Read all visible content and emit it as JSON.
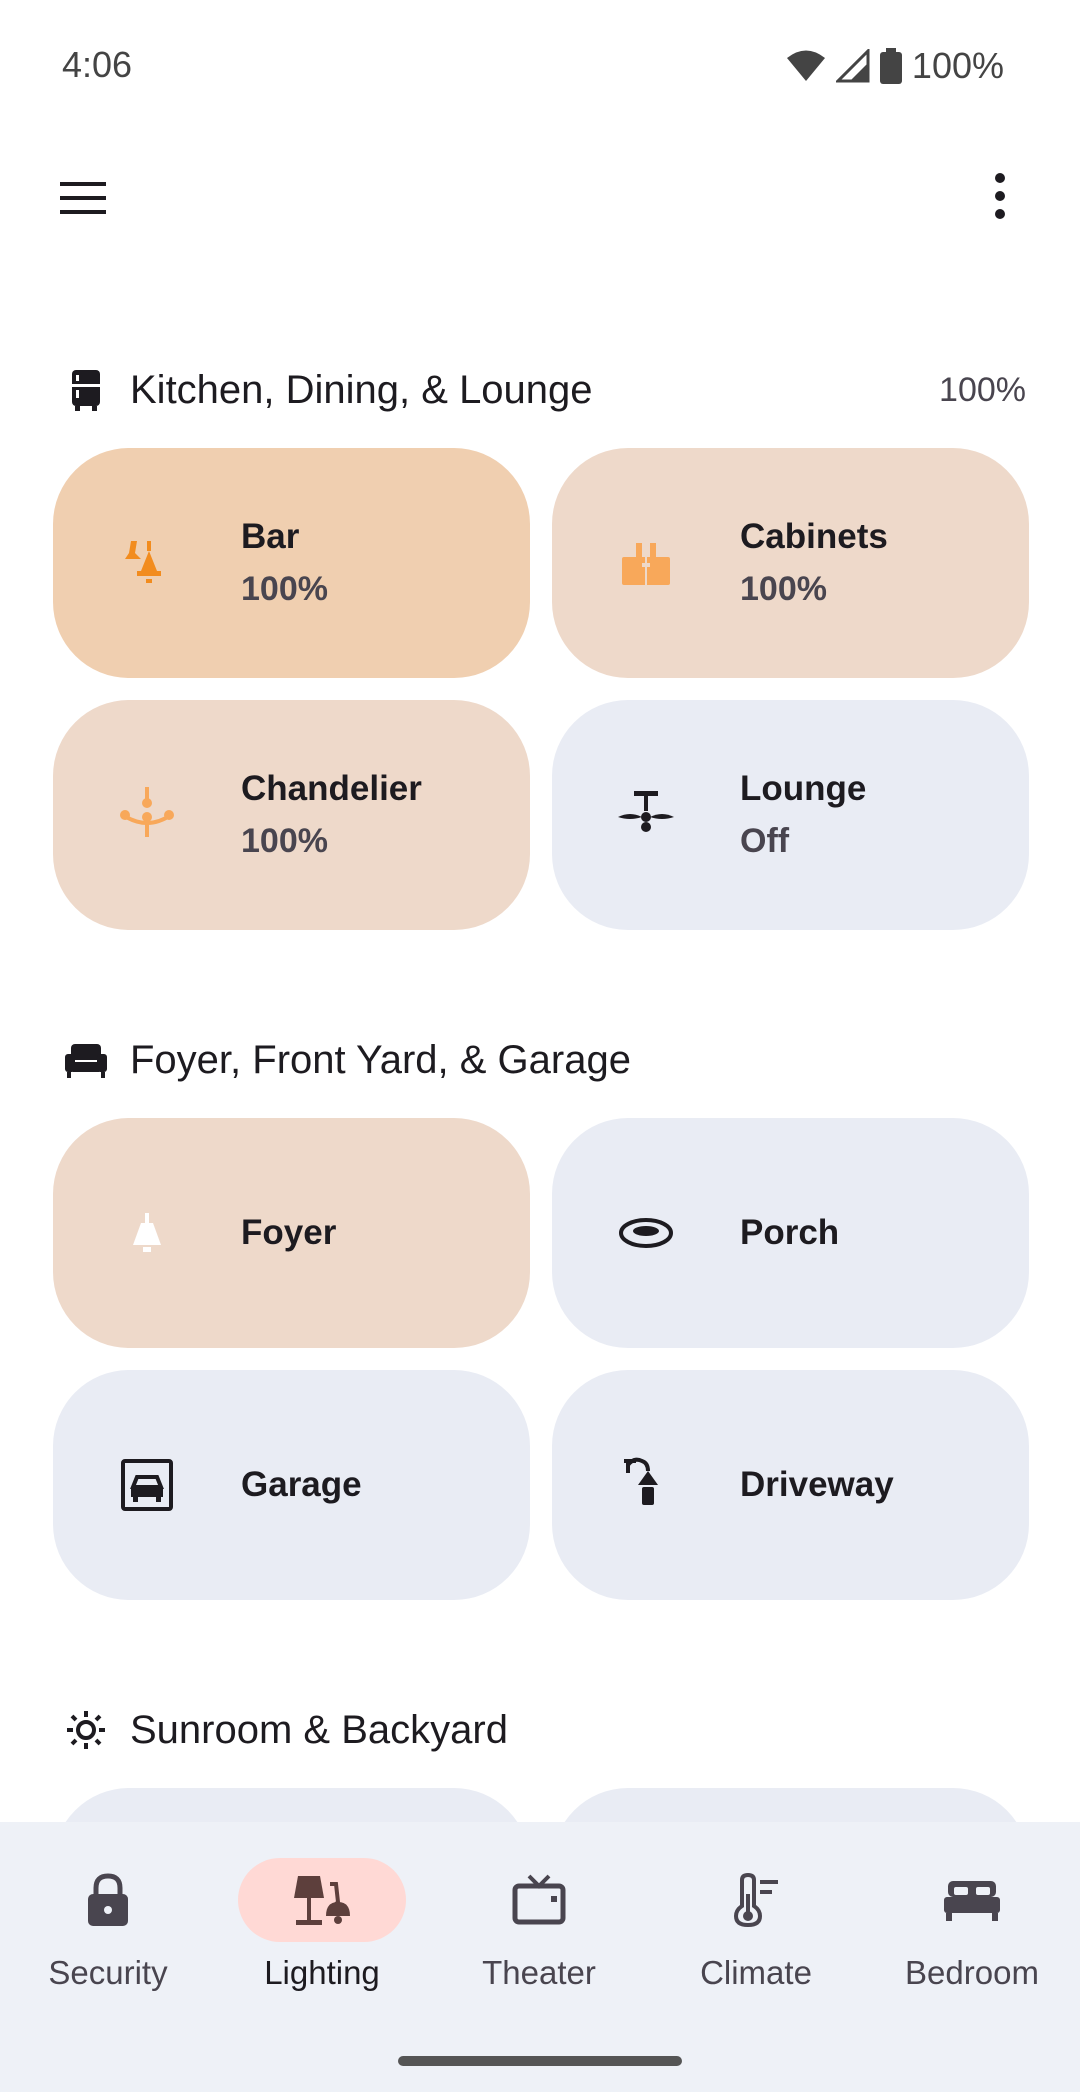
{
  "status_bar": {
    "time": "4:06",
    "battery": "100%"
  },
  "colors": {
    "accent_orange": "#f28c1e",
    "tile_on_strong": "#f0cfb0",
    "tile_on": "#eed9ca",
    "tile_off": "#e9ecf4",
    "nav_active": "#ffd9d5"
  },
  "sections": [
    {
      "title": "Kitchen, Dining, & Lounge",
      "icon": "fridge-icon",
      "level": "100%",
      "tiles": [
        {
          "name": "Bar",
          "state": "100%",
          "icon": "pendant-lamps-icon",
          "on": true
        },
        {
          "name": "Cabinets",
          "state": "100%",
          "icon": "cabinet-light-icon",
          "on": true
        },
        {
          "name": "Chandelier",
          "state": "100%",
          "icon": "chandelier-icon",
          "on": true
        },
        {
          "name": "Lounge",
          "state": "Off",
          "icon": "ceiling-fan-light-icon",
          "on": false
        }
      ]
    },
    {
      "title": "Foyer, Front Yard, & Garage",
      "icon": "sofa-icon",
      "tiles": [
        {
          "name": "Foyer",
          "icon": "wall-lamp-icon",
          "on": true
        },
        {
          "name": "Porch",
          "icon": "flush-mount-light-icon",
          "on": false
        },
        {
          "name": "Garage",
          "icon": "garage-car-icon",
          "on": false
        },
        {
          "name": "Driveway",
          "icon": "outdoor-lamp-icon",
          "on": false
        }
      ]
    },
    {
      "title": "Sunroom & Backyard",
      "icon": "sun-icon"
    }
  ],
  "bottom_nav": [
    {
      "label": "Security",
      "icon": "lock-icon",
      "active": false
    },
    {
      "label": "Lighting",
      "icon": "lamp-icon",
      "active": true
    },
    {
      "label": "Theater",
      "icon": "tv-icon",
      "active": false
    },
    {
      "label": "Climate",
      "icon": "thermometer-icon",
      "active": false
    },
    {
      "label": "Bedroom",
      "icon": "bed-icon",
      "active": false
    }
  ]
}
